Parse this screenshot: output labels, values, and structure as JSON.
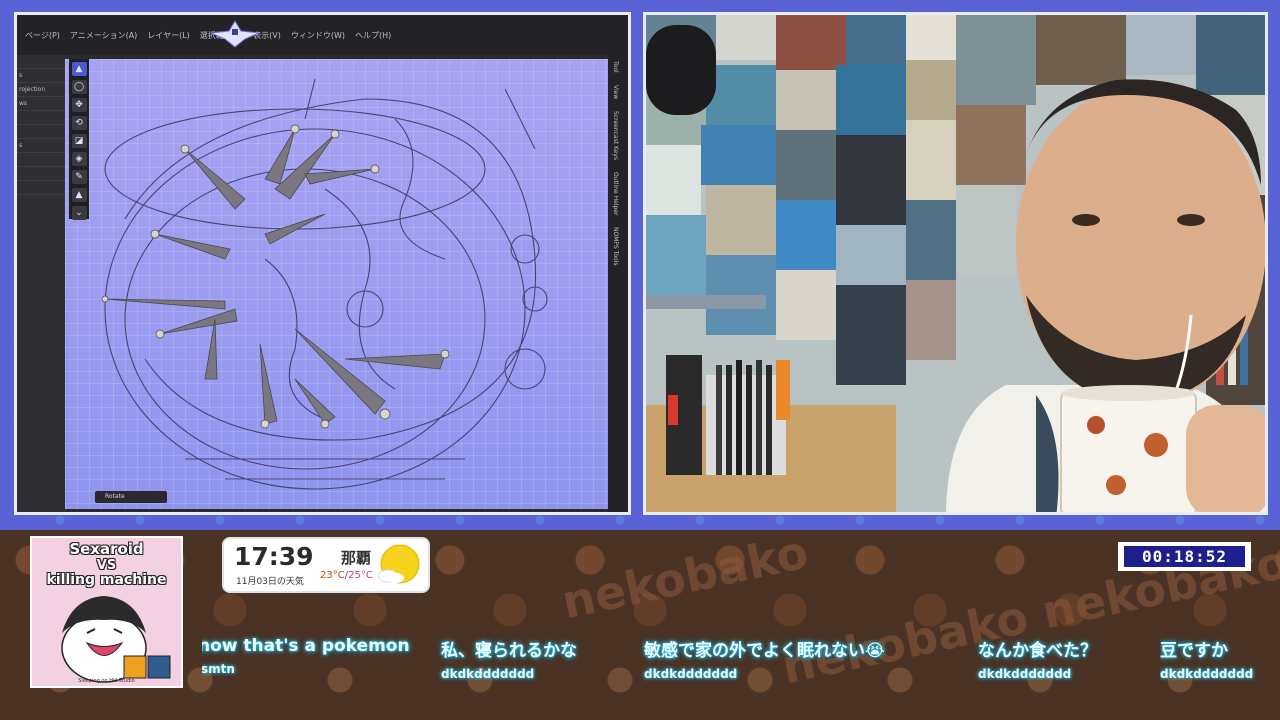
{
  "app": {
    "menu": [
      "ページ(P)",
      "アニメーション(A)",
      "レイヤー(L)",
      "選択範囲(S)",
      "表示(V)",
      "ウィンドウ(W)",
      "ヘルプ(H)"
    ],
    "left_panel": [
      "",
      "s",
      "rojection",
      "ws",
      "",
      "",
      "s"
    ],
    "tools": [
      "▲",
      "◯",
      "✥",
      "⟲",
      "◪",
      "◈",
      "✎",
      "▲",
      "⌄"
    ],
    "right_tabs": [
      "Tool",
      "View",
      "Screencast Keys",
      "Outline Helper",
      "NOMPS Tools"
    ],
    "footer_label": "Rotate"
  },
  "overlay": {
    "game": {
      "title_line1": "Sexaroid",
      "title_vs": "VS",
      "title_line2": "killing machine",
      "credit": "Sleeping on Hill Studio"
    },
    "clock": {
      "time": "17:39",
      "date": "11月03日の天気"
    },
    "weather": {
      "city": "那覇",
      "temp_low": "23°C",
      "temp_separator": "/",
      "temp_high": "25°C",
      "icon": "sunny-cloud-icon"
    },
    "timer": "00:18:52",
    "chat": [
      {
        "text": "now that's a pokemon",
        "user": "smtn"
      },
      {
        "text": "私、寝られるかな",
        "user": "dkdkddddddd"
      },
      {
        "text": "敏感で家の外でよく眠れない😭",
        "user": "dkdkddddddd"
      },
      {
        "text": "なんか食べた？",
        "user": "dkdkddddddd"
      },
      {
        "text": "豆ですか",
        "user": "dkdkddddddd"
      }
    ],
    "background_words": [
      "nekobako",
      "nekobako",
      "nekobako"
    ]
  },
  "colors": {
    "frame_border": "#e9ecff",
    "canvas": "#9a9ff0",
    "chat_glow": "#29c9e6",
    "timer_bg": "#1d1f8e"
  }
}
